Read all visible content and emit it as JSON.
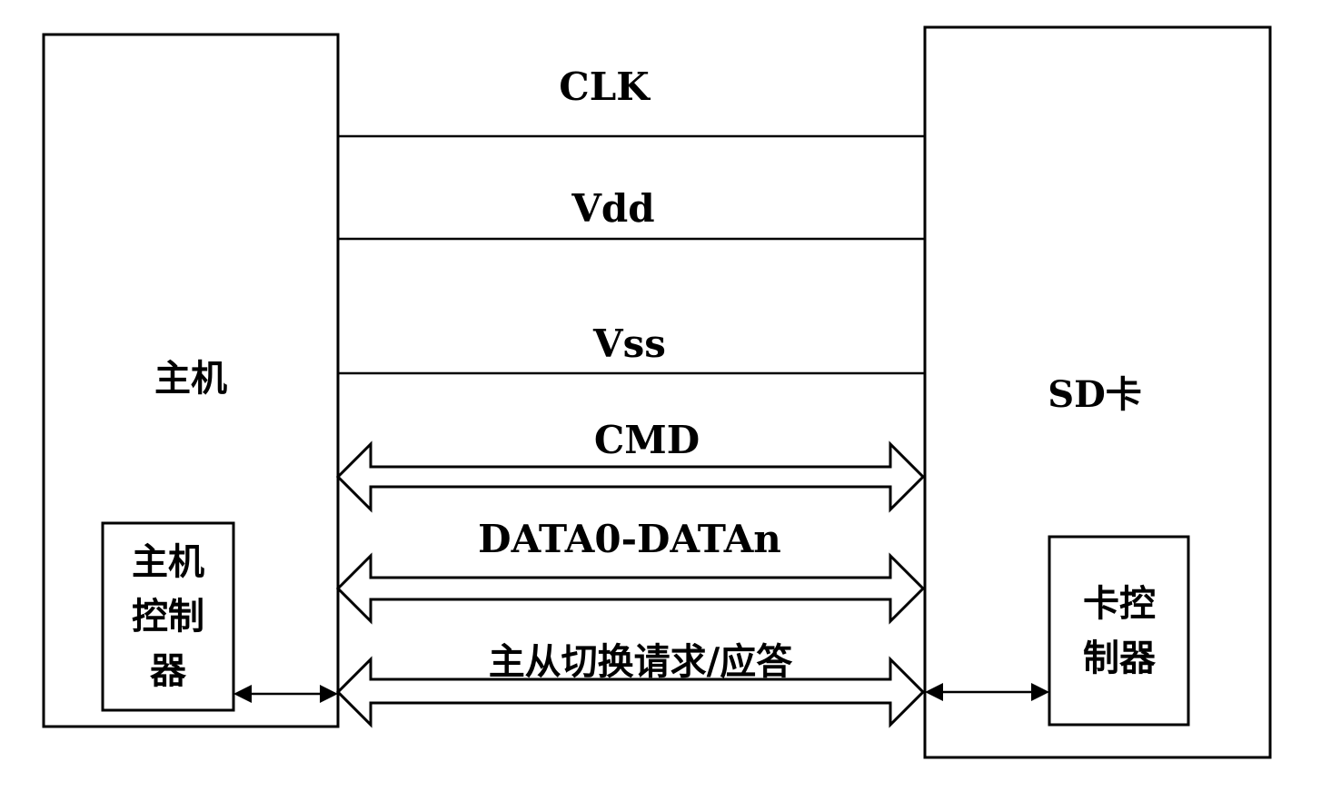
{
  "host": {
    "label": "主机",
    "controller_lines": [
      "主机",
      "控制",
      "器"
    ]
  },
  "card": {
    "label": "SD卡",
    "controller_lines": [
      "卡控",
      "制器"
    ]
  },
  "signals": {
    "clk": "CLK",
    "vdd": "Vdd",
    "vss": "Vss"
  },
  "buses": {
    "cmd": "CMD",
    "data": "DATA0-DATAn",
    "switch": "主从切换请求/应答"
  }
}
